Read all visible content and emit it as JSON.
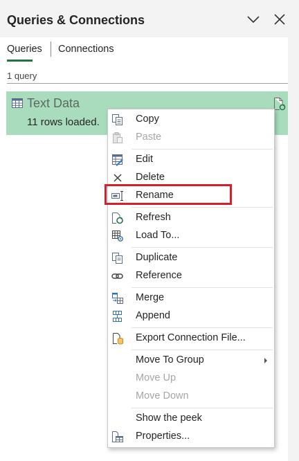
{
  "pane": {
    "title": "Queries & Connections",
    "tabs": [
      {
        "label": "Queries",
        "active": true
      },
      {
        "label": "Connections",
        "active": false
      }
    ],
    "query_count": "1 query",
    "accent_color": "#217346"
  },
  "query": {
    "name": "Text Data",
    "status": "11 rows loaded.",
    "highlight_color": "#a9dcbd"
  },
  "context_menu": {
    "items": [
      {
        "label": "Copy",
        "icon": "copy-icon",
        "enabled": true
      },
      {
        "label": "Paste",
        "icon": "paste-icon",
        "enabled": false
      },
      {
        "label": "Edit",
        "icon": "edit-icon",
        "enabled": true
      },
      {
        "label": "Delete",
        "icon": "delete-icon",
        "enabled": true
      },
      {
        "label": "Rename",
        "icon": "rename-icon",
        "enabled": true
      },
      {
        "label": "Refresh",
        "icon": "refresh-icon",
        "enabled": true
      },
      {
        "label": "Load To...",
        "icon": "load-to-icon",
        "enabled": true
      },
      {
        "label": "Duplicate",
        "icon": "duplicate-icon",
        "enabled": true
      },
      {
        "label": "Reference",
        "icon": "reference-icon",
        "enabled": true
      },
      {
        "label": "Merge",
        "icon": "merge-icon",
        "enabled": true
      },
      {
        "label": "Append",
        "icon": "append-icon",
        "enabled": true
      },
      {
        "label": "Export Connection File...",
        "icon": "export-connection-icon",
        "enabled": true
      },
      {
        "label": "Move To Group",
        "icon": "",
        "enabled": true,
        "submenu": true
      },
      {
        "label": "Move Up",
        "icon": "",
        "enabled": false
      },
      {
        "label": "Move Down",
        "icon": "",
        "enabled": false
      },
      {
        "label": "Show the peek",
        "icon": "",
        "enabled": true
      },
      {
        "label": "Properties...",
        "icon": "properties-icon",
        "enabled": true
      }
    ],
    "highlighted_item": "Rename",
    "highlight_color": "#d81e2c"
  }
}
